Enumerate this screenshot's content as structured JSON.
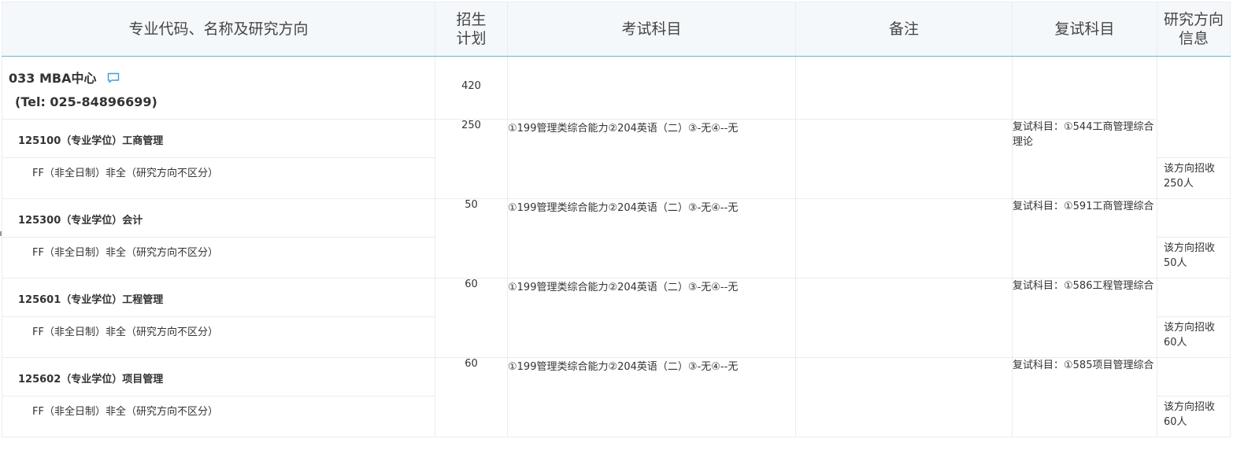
{
  "header": {
    "col_major": "专业代码、名称及研究方向",
    "col_plan_line1": "招生",
    "col_plan_line2": "计划",
    "col_exam": "考试科目",
    "col_note": "备注",
    "col_retest": "复试科目",
    "col_dirinfo_line1": "研究方向",
    "col_dirinfo_line2": "信息"
  },
  "department": {
    "name": "033 MBA中心",
    "tel": "(Tel:  025-84896699)",
    "plan": "420",
    "icon": "chat-bubble-icon"
  },
  "majors": [
    {
      "title": "125100（专业学位）工商管理",
      "plan": "250",
      "exam": "①199管理类综合能力②204英语（二）③-无④--无",
      "retest": "复试科目：①544工商管理综合理论",
      "direction": "FF（非全日制）非全（研究方向不区分）",
      "direction_info": "该方向招收250人"
    },
    {
      "title": "125300（专业学位）会计",
      "plan": "50",
      "exam": "①199管理类综合能力②204英语（二）③-无④--无",
      "retest": "复试科目：①591工商管理综合",
      "direction": "FF（非全日制）非全（研究方向不区分）",
      "direction_info": "该方向招收50人"
    },
    {
      "title": "125601（专业学位）工程管理",
      "plan": "60",
      "exam": "①199管理类综合能力②204英语（二）③-无④--无",
      "retest": "复试科目：①586工程管理综合",
      "direction": "FF（非全日制）非全（研究方向不区分）",
      "direction_info": "该方向招收60人"
    },
    {
      "title": "125602（专业学位）项目管理",
      "plan": "60",
      "exam": "①199管理类综合能力②204英语（二）③-无④--无",
      "retest": "复试科目：①585项目管理综合",
      "direction": "FF（非全日制）非全（研究方向不区分）",
      "direction_info": "该方向招收60人"
    }
  ],
  "colors": {
    "header_bg": "#f5f8fb",
    "header_border": "#6bb5cf",
    "grid_line": "#e8edf2",
    "icon_blue": "#3a9de0"
  }
}
